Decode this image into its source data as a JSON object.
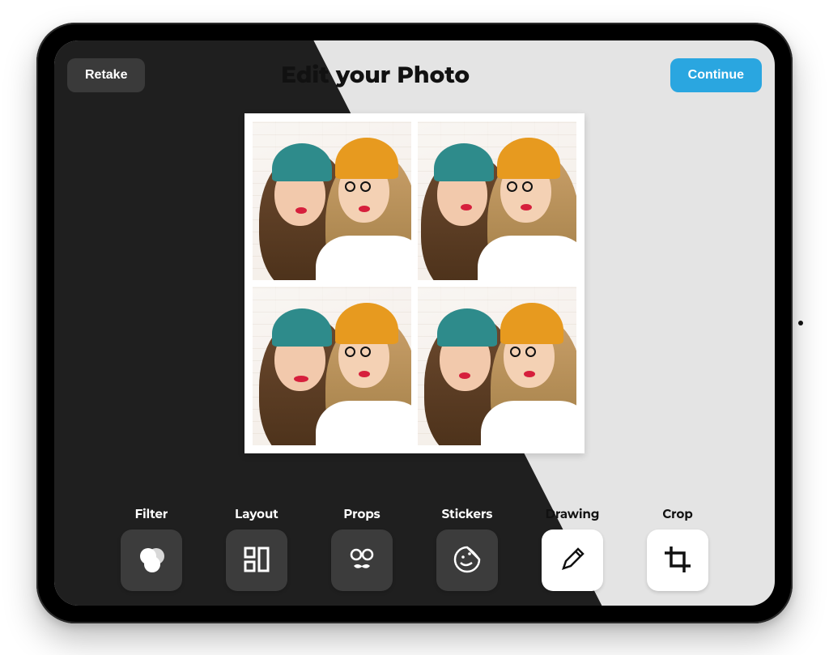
{
  "header": {
    "retake_label": "Retake",
    "title": "Edit your Photo",
    "continue_label": "Continue"
  },
  "colors": {
    "continue_button": "#2aa6e0",
    "dark_panel": "#1f1f1f"
  },
  "collage": {
    "layout": "2x2",
    "tiles": 4
  },
  "tools": [
    {
      "id": "filter",
      "label": "Filter",
      "icon": "filter-overlap-circles",
      "theme": "dark"
    },
    {
      "id": "layout",
      "label": "Layout",
      "icon": "layout-grid",
      "theme": "dark"
    },
    {
      "id": "props",
      "label": "Props",
      "icon": "glasses-mustache",
      "theme": "dark"
    },
    {
      "id": "stickers",
      "label": "Stickers",
      "icon": "sticker-peel",
      "theme": "dark"
    },
    {
      "id": "drawing",
      "label": "Drawing",
      "icon": "pencil",
      "theme": "light"
    },
    {
      "id": "crop",
      "label": "Crop",
      "icon": "crop",
      "theme": "light"
    }
  ]
}
